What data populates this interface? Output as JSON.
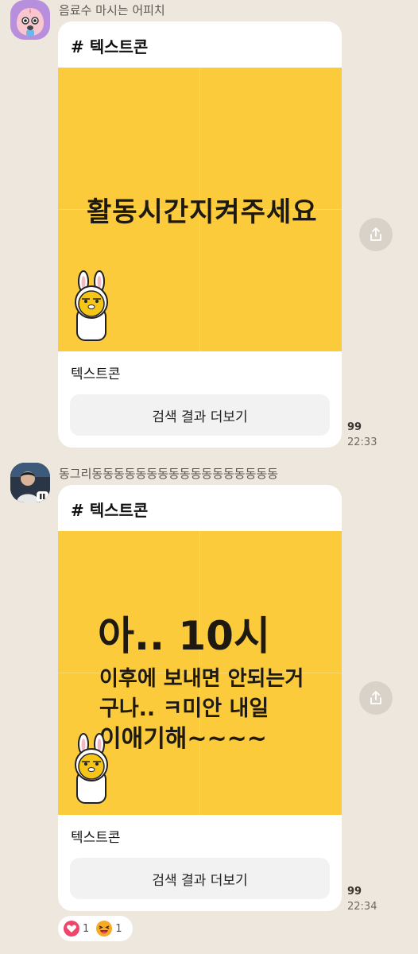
{
  "messages": [
    {
      "sender": "음료수 마시는 어피치",
      "card_header": "# 텍스트콘",
      "sticker_lines": [
        "활동시간지켜주세요"
      ],
      "card_title": "텍스트콘",
      "more_button": "검색 결과 더보기",
      "unread_count": "99",
      "time": "22:33"
    },
    {
      "sender": "동그리동동동동동동동동동동동동동동동동동",
      "card_header": "# 텍스트콘",
      "sticker_lines": [
        "아.. 10시",
        "이후에 보내면 안되는거",
        "구나.. ㅋ미안 내일",
        "이애기해~~~~"
      ],
      "card_title": "텍스트콘",
      "more_button": "검색 결과 더보기",
      "unread_count": "99",
      "time": "22:34"
    }
  ],
  "reactions": [
    {
      "icon": "heart-icon",
      "count": "1",
      "color": "#f0446a"
    },
    {
      "icon": "laughing-emoji-icon",
      "count": "1",
      "color": "#f7a928"
    }
  ],
  "colors": {
    "background": "#ede7dd",
    "sticker_yellow": "#fbcb3b",
    "card": "#ffffff"
  }
}
